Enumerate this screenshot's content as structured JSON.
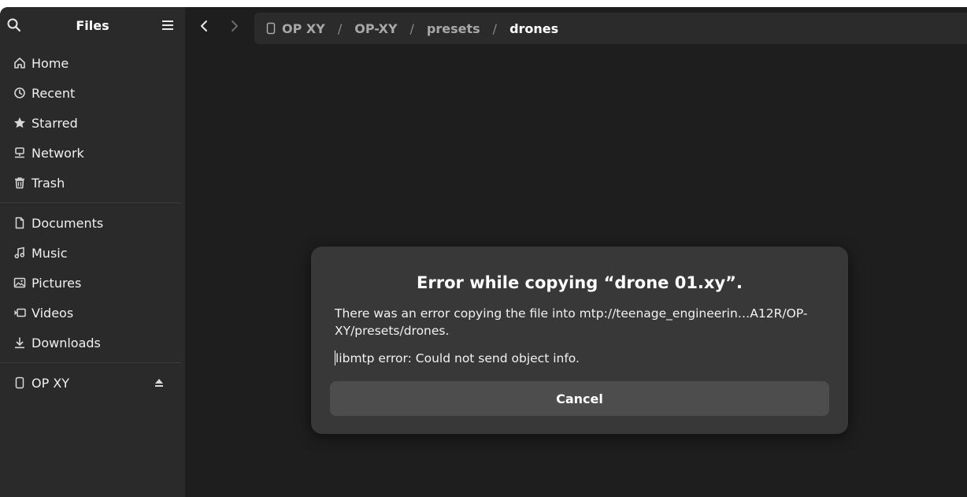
{
  "sidebar": {
    "title": "Files",
    "places": [
      {
        "label": "Home",
        "icon": "home-icon"
      },
      {
        "label": "Recent",
        "icon": "clock-icon"
      },
      {
        "label": "Starred",
        "icon": "star-icon"
      },
      {
        "label": "Network",
        "icon": "network-icon"
      },
      {
        "label": "Trash",
        "icon": "trash-icon"
      }
    ],
    "bookmarks": [
      {
        "label": "Documents",
        "icon": "document-icon"
      },
      {
        "label": "Music",
        "icon": "music-icon"
      },
      {
        "label": "Pictures",
        "icon": "picture-icon"
      },
      {
        "label": "Videos",
        "icon": "video-icon"
      },
      {
        "label": "Downloads",
        "icon": "download-icon"
      }
    ],
    "devices": [
      {
        "label": "OP XY",
        "icon": "phone-icon"
      }
    ]
  },
  "pathbar": {
    "crumbs": [
      "OP XY",
      "OP-XY",
      "presets",
      "drones"
    ],
    "separator": "/"
  },
  "dialog": {
    "heading": "Error while copying “drone 01.xy”.",
    "body": "There was an error copying the file into mtp://teenage_engineerin…A12R/OP-XY/presets/drones.",
    "detail": "libmtp error:  Could not send object info.",
    "cancel_label": "Cancel"
  },
  "colors": {
    "window_bg": "#1e1e1e",
    "sidebar_bg": "#2a2a2a",
    "dialog_bg": "#383838",
    "button_bg": "#4d4d4d"
  }
}
